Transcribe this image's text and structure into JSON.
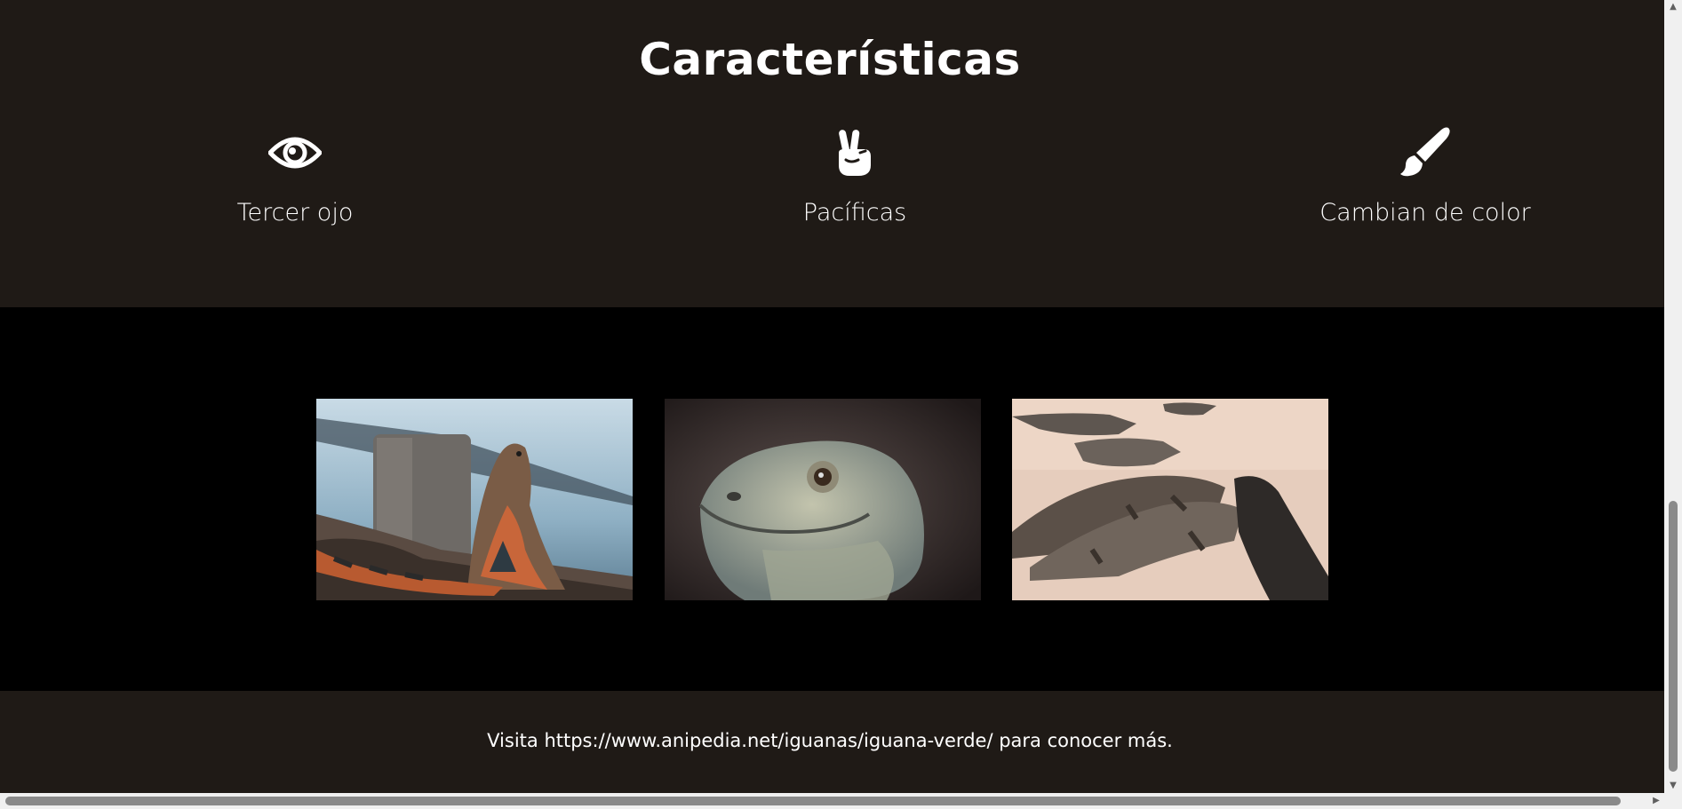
{
  "features": {
    "title": "Características",
    "items": [
      {
        "icon": "eye-icon",
        "label": "Tercer ojo"
      },
      {
        "icon": "peace-hand-icon",
        "label": "Pacíficas"
      },
      {
        "icon": "paintbrush-icon",
        "label": "Cambian de color"
      }
    ]
  },
  "gallery": {
    "images": [
      {
        "subject": "orange iguana on rocky shore"
      },
      {
        "subject": "iguana head close-up"
      },
      {
        "subject": "group of iguanas on sand"
      }
    ]
  },
  "footer": {
    "text": "Visita https://www.anipedia.net/iguanas/iguana-verde/ para conocer más."
  },
  "colors": {
    "section_bg": "#1f1a16",
    "gallery_bg": "#000000",
    "text": "#ffffff"
  }
}
